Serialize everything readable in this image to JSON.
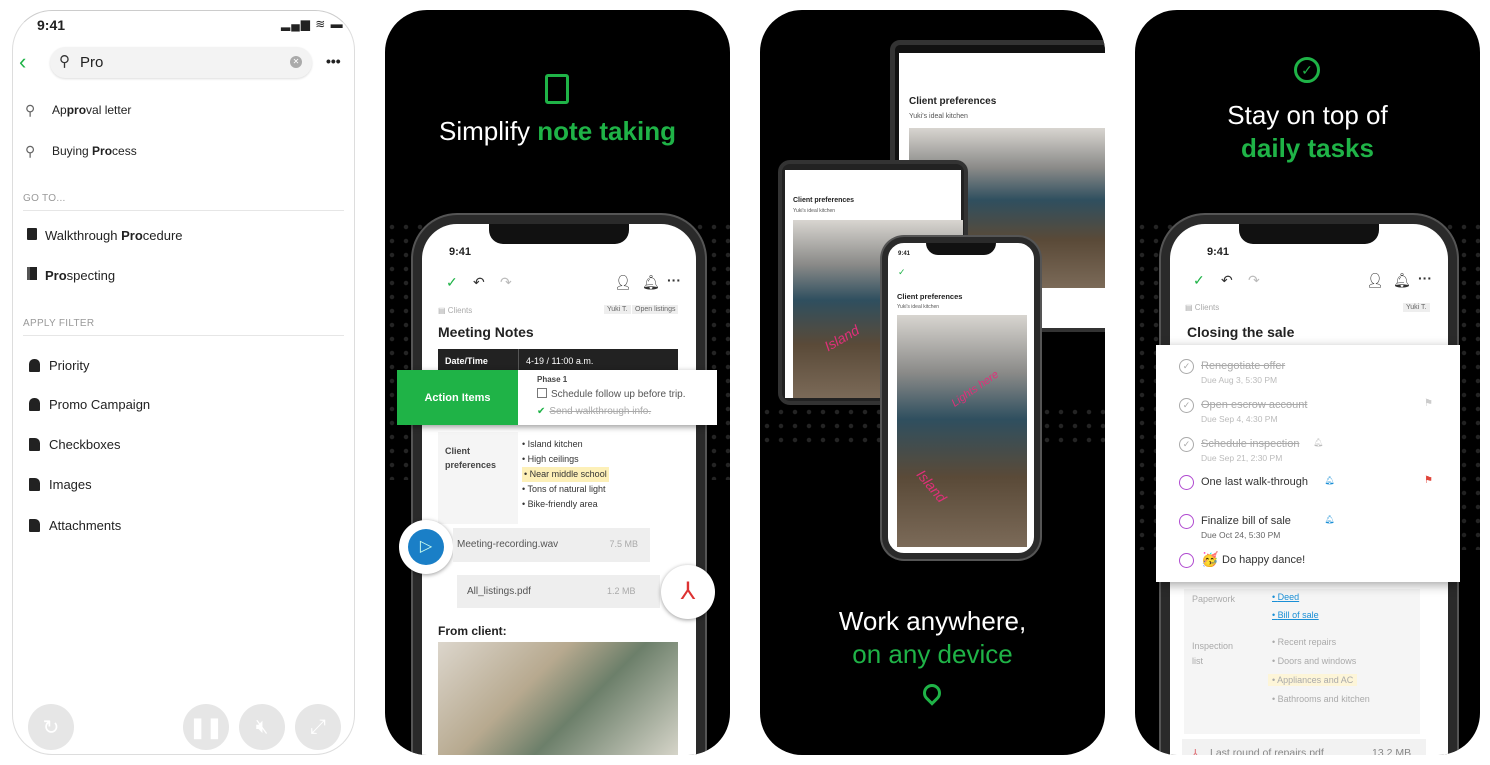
{
  "search_screen": {
    "status_time": "9:41",
    "search": {
      "value": "Pro",
      "placeholder": ""
    },
    "suggestions": [
      {
        "pre": "Ap",
        "match": "pro",
        "post": "val letter"
      },
      {
        "pre": "Buying ",
        "match": "Pro",
        "post": "cess"
      }
    ],
    "goto_label": "GO TO...",
    "goto_items": [
      {
        "pre": "Walkthrough ",
        "match": "Pro",
        "post": "cedure",
        "icon": "note-icon"
      },
      {
        "pre": "",
        "match": "Pro",
        "post": "specting",
        "icon": "notebook-icon"
      }
    ],
    "filter_label": "APPLY FILTER",
    "filters": [
      {
        "label": "Priority",
        "icon": "tag-icon"
      },
      {
        "label": "Promo Campaign",
        "icon": "tag-icon"
      },
      {
        "label": "Checkboxes",
        "icon": "attachment-note-icon"
      },
      {
        "label": "Images",
        "icon": "attachment-note-icon"
      },
      {
        "label": "Attachments",
        "icon": "attachment-note-icon"
      }
    ]
  },
  "player_controls": [
    "replay",
    "pause",
    "mute",
    "fullscreen"
  ],
  "colors": {
    "accent": "#1fb347",
    "link": "#1a8fd6",
    "flag": "#e0453a",
    "task_circle": "#b04ad0"
  },
  "panel_notes": {
    "headline_white": "Simplify",
    "headline_green": "note taking",
    "status_time": "9:41",
    "notebook": "Clients",
    "tags": [
      "Yuki T.",
      "Open listings"
    ],
    "title": "Meeting Notes",
    "table_header": [
      "Date/Time",
      "4-19 / 11:00 a.m."
    ],
    "action_label": "Action Items",
    "phase": "Phase 1",
    "todo": [
      {
        "text": "Schedule follow up before trip.",
        "checked": false
      },
      {
        "text": "Send walkthrough info.",
        "checked": true
      }
    ],
    "pref_label": "Client preferences",
    "prefs": [
      "Island kitchen",
      "High ceilings",
      "Near middle school",
      "Tons of natural light",
      "Bike-friendly area"
    ],
    "audio": {
      "name": "Meeting-recording.wav",
      "size": "7.5 MB"
    },
    "pdf": {
      "name": "All_listings.pdf",
      "size": "1.2 MB"
    },
    "from_client": "From client:"
  },
  "panel_devices": {
    "title": "Client preferences",
    "subtitle": "Yuki's ideal kitchen",
    "handwriting": [
      "Island",
      "Lights here"
    ],
    "headline_white": "Work anywhere,",
    "headline_green": "on any device",
    "status_time": "9:41"
  },
  "panel_tasks": {
    "headline_white": "Stay on top of",
    "headline_green": "daily tasks",
    "status_time": "9:41",
    "notebook": "Clients",
    "tag": "Yuki T.",
    "title": "Closing the sale",
    "tasks": [
      {
        "text": "Renegotiate offer",
        "due": "Due Aug 3, 5:30 PM",
        "done": true,
        "reminder": false,
        "flag": false
      },
      {
        "text": "Open escrow account",
        "due": "Due Sep 4, 4:30 PM",
        "done": true,
        "reminder": false,
        "flag": "grey"
      },
      {
        "text": "Schedule inspection",
        "due": "Due Sep 21, 2:30 PM",
        "done": true,
        "reminder": true,
        "flag": false
      },
      {
        "text": "One last walk-through",
        "due": "",
        "done": false,
        "reminder": true,
        "flag": "red"
      },
      {
        "text": "Finalize bill of sale",
        "due": "Due Oct 24, 5:30 PM",
        "done": false,
        "reminder": true,
        "flag": false
      },
      {
        "text": "Do happy dance!",
        "due": "",
        "done": false,
        "reminder": false,
        "flag": false,
        "emoji": "🥳"
      }
    ],
    "paperwork_label": "Paperwork",
    "paperwork": [
      "Deed",
      "Bill of sale"
    ],
    "inspection_label": "Inspection list",
    "inspection": [
      "Recent repairs",
      "Doors and windows",
      "Appliances and AC",
      "Bathrooms and kitchen"
    ],
    "pdf": {
      "name": "Last round of repairs.pdf",
      "size": "13.2 MB"
    }
  }
}
